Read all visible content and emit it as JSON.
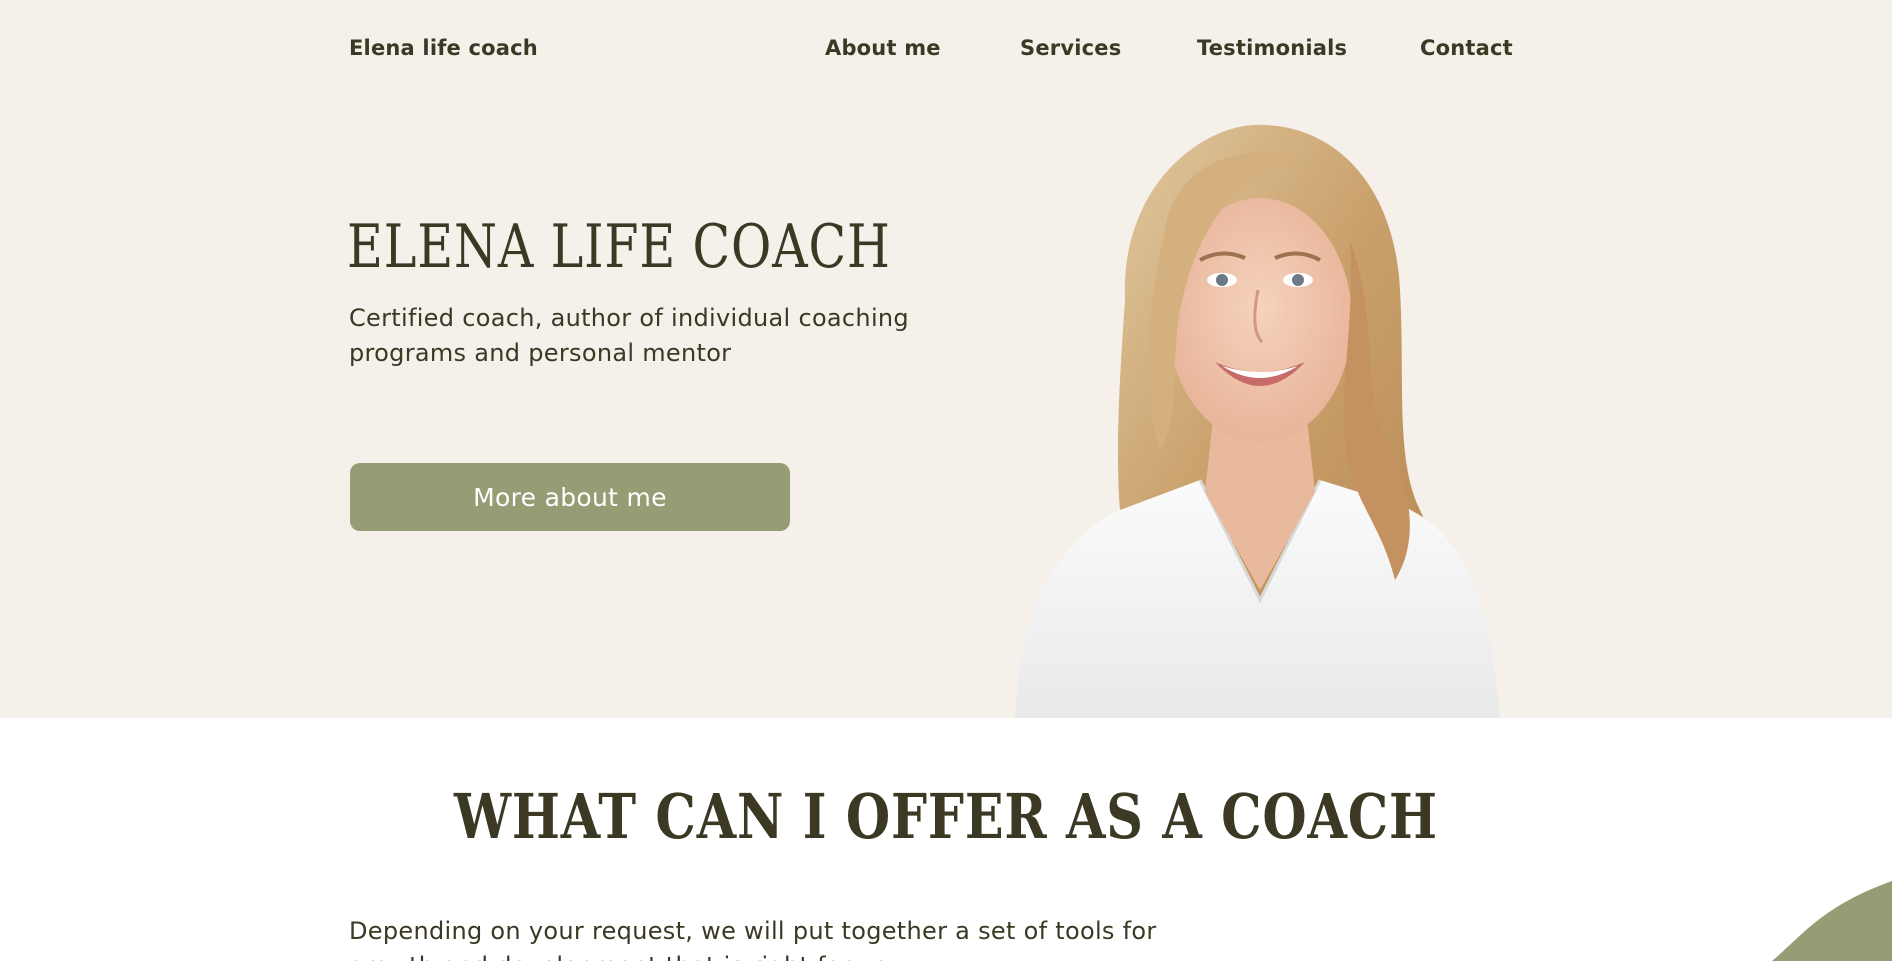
{
  "header": {
    "brand": "Elena life coach",
    "nav": {
      "about": "About me",
      "services": "Services",
      "testimonials": "Testimonials",
      "contact": "Contact"
    }
  },
  "hero": {
    "title": "ELENA LIFE COACH",
    "subtitle": "Certified coach, author of individual coaching programs and personal mentor",
    "button_label": "More about me",
    "portrait_icon": "portrait-photo"
  },
  "offer": {
    "title": "WHAT CAN I OFFER AS A COACH",
    "text": "Depending on your request, we will put together a set of tools for growth and development that is right for you"
  },
  "colors": {
    "hero_bg": "#f5f0ea",
    "accent": "#969d75",
    "text": "#3b3824"
  }
}
